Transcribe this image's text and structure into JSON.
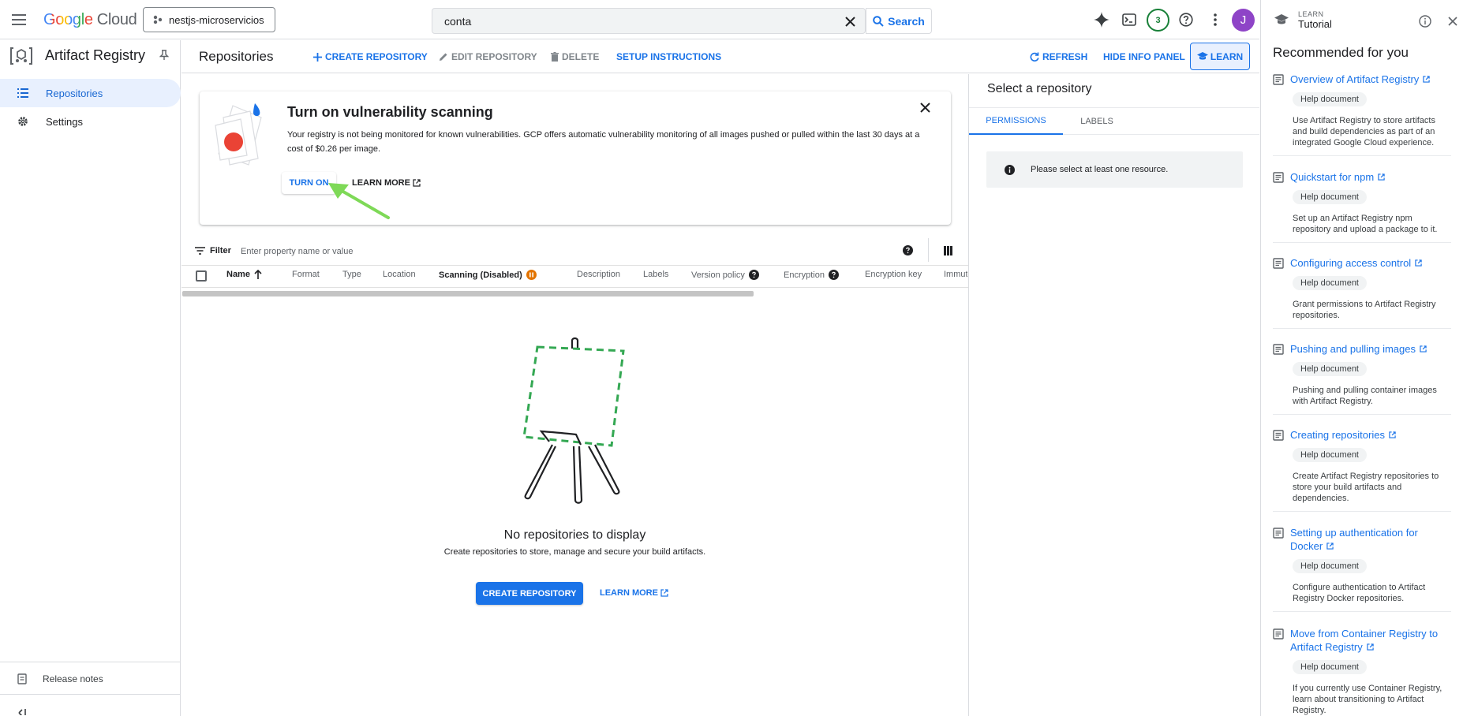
{
  "topbar": {
    "logo_google": "Google",
    "logo_cloud": "Cloud",
    "project": "nestjs-microservicios",
    "search_value": "conta",
    "search_button": "Search",
    "notifications_count": "3",
    "avatar_letter": "J"
  },
  "nav": {
    "title": "Artifact Registry",
    "items": [
      {
        "label": "Repositories"
      },
      {
        "label": "Settings"
      }
    ],
    "release_notes": "Release notes"
  },
  "toolbar": {
    "title": "Repositories",
    "create": "CREATE REPOSITORY",
    "edit": "EDIT REPOSITORY",
    "delete": "DELETE",
    "setup": "SETUP INSTRUCTIONS",
    "refresh": "REFRESH",
    "hide_info": "HIDE INFO PANEL",
    "learn": "LEARN"
  },
  "banner": {
    "title": "Turn on vulnerability scanning",
    "body": "Your registry is not being monitored for known vulnerabilities. GCP offers automatic vulnerability monitoring of all images pushed or pulled within the last 30 days at a cost of $0.26 per image.",
    "turn_on": "TURN ON",
    "learn_more": "LEARN MORE"
  },
  "filter": {
    "label": "Filter",
    "placeholder": "Enter property name or value"
  },
  "table": {
    "columns": [
      "Name",
      "Format",
      "Type",
      "Location",
      "Scanning (Disabled)",
      "Description",
      "Labels",
      "Version policy",
      "Encryption",
      "Encryption key",
      "Immut"
    ]
  },
  "empty": {
    "title": "No repositories to display",
    "subtitle": "Create repositories to store, manage and secure your build artifacts.",
    "create": "CREATE REPOSITORY",
    "learn_more": "LEARN MORE"
  },
  "info_panel": {
    "title": "Select a repository",
    "tabs": [
      "PERMISSIONS",
      "LABELS"
    ],
    "message": "Please select at least one resource."
  },
  "learn_panel": {
    "kicker": "LEARN",
    "title": "Tutorial",
    "heading": "Recommended for you",
    "items": [
      {
        "title": "Overview of Artifact Registry",
        "chip": "Help document",
        "desc": "Use Artifact Registry to store artifacts and build dependencies as part of an integrated Google Cloud experience."
      },
      {
        "title": "Quickstart for npm",
        "chip": "Help document",
        "desc": "Set up an Artifact Registry npm repository and upload a package to it."
      },
      {
        "title": "Configuring access control",
        "chip": "Help document",
        "desc": "Grant permissions to Artifact Registry repositories."
      },
      {
        "title": "Pushing and pulling images",
        "chip": "Help document",
        "desc": "Pushing and pulling container images with Artifact Registry."
      },
      {
        "title": "Creating repositories",
        "chip": "Help document",
        "desc": "Create Artifact Registry repositories to store your build artifacts and dependencies."
      },
      {
        "title": "Setting up authentication for Docker",
        "chip": "Help document",
        "desc": "Configure authentication to Artifact Registry Docker repositories."
      },
      {
        "title": "Move from Container Registry to Artifact Registry",
        "chip": "Help document",
        "desc": "If you currently use Container Registry, learn about transitioning to Artifact Registry."
      }
    ]
  },
  "colors": {
    "accent": "#1a73e8",
    "primary_button": "#1a73e8",
    "annotation_arrow": "#7ed957",
    "empty_illustration": "#34a853"
  }
}
